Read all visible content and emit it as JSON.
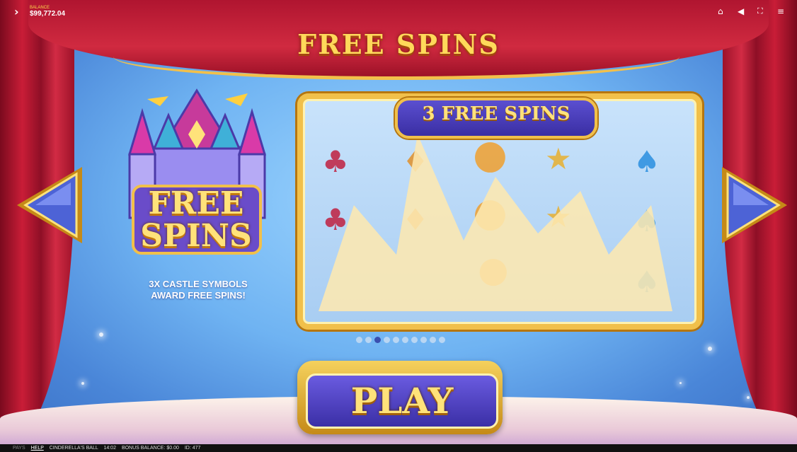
{
  "balance": {
    "label": "BALANCE",
    "value": "$99,772.04"
  },
  "toolbar": {
    "icons": [
      "home-icon",
      "sound-icon",
      "fullscreen-icon",
      "menu-icon"
    ]
  },
  "title": "FREE SPINS",
  "feature": {
    "logo_text_line1": "FREE",
    "logo_text_line2": "SPINS",
    "caption_line1": "3X CASTLE SYMBOLS",
    "caption_line2": "AWARD FREE SPINS!"
  },
  "preview": {
    "banner": "3 FREE SPINS"
  },
  "pagination": {
    "total": 10,
    "active_index": 2
  },
  "play_label": "PLAY",
  "footer": {
    "pays": "PAYS",
    "help": "HELP",
    "game": "CINDERELLA'S BALL",
    "time": "14:02",
    "bonus_balance": "BONUS BALANCE: $0.00",
    "id": "ID: 477"
  },
  "colors": {
    "gold": "#ffd95a",
    "curtain": "#c91d37",
    "sky": "#6fb3f2",
    "royal": "#3b2fa6"
  }
}
